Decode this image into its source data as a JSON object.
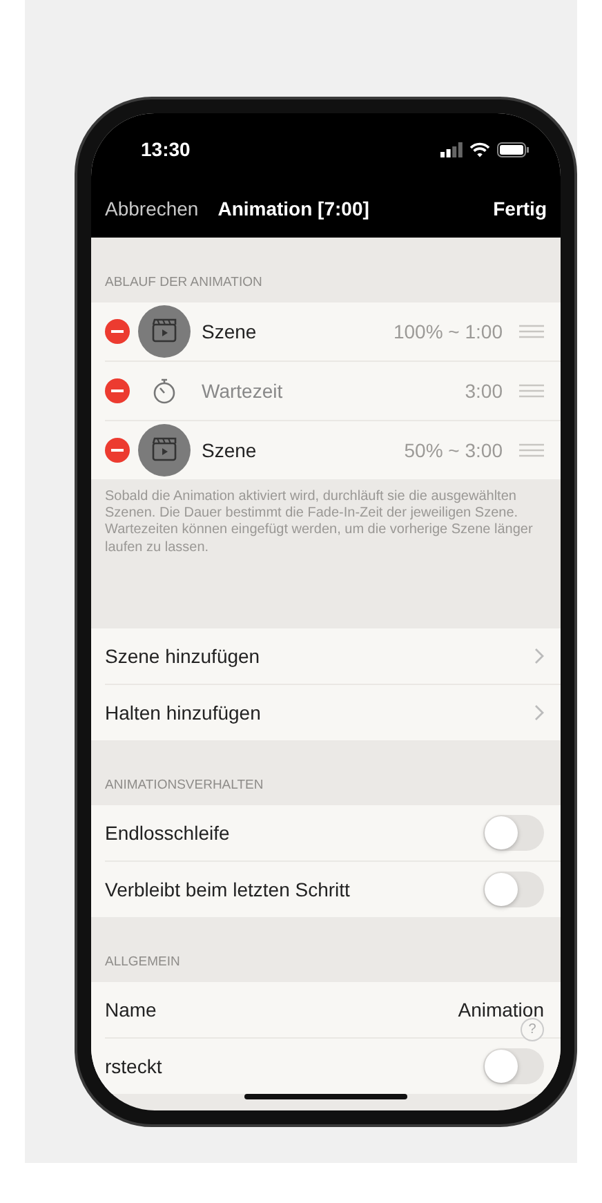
{
  "status_bar": {
    "time": "13:30"
  },
  "help": {
    "label": "?"
  },
  "nav": {
    "cancel": "Abbrechen",
    "title": "Animation [7:00]",
    "done": "Fertig"
  },
  "sections": [
    {
      "kind": "steps",
      "header": "ABLAUF DER ANIMATION",
      "footer": "Sobald die Animation aktiviert wird, durchläuft sie die ausgewählten Szenen. Die Dauer bestimmt die Fade-In-Zeit der jeweiligen Szene. Wartezeiten können eingefügt werden, um die vorherige Szene länger laufen zu lassen.",
      "rows": [
        {
          "kind": "scene",
          "label": "Szene",
          "value": "100% ~ 1:00"
        },
        {
          "kind": "wait",
          "label": "Wartezeit",
          "value": "3:00"
        },
        {
          "kind": "scene",
          "label": "Szene",
          "value": "50% ~ 3:00"
        }
      ]
    },
    {
      "kind": "links",
      "rows": [
        {
          "label": "Szene hinzufügen"
        },
        {
          "label": "Halten hinzufügen"
        }
      ]
    },
    {
      "kind": "toggles",
      "header": "ANIMATIONSVERHALTEN",
      "rows": [
        {
          "label": "Endlosschleife",
          "on": false
        },
        {
          "label": "Verbleibt beim letzten Schritt",
          "on": false
        }
      ]
    },
    {
      "kind": "general",
      "header": "ALLGEMEIN",
      "rows": [
        {
          "kind": "value",
          "label": "Name",
          "value": "Animation"
        },
        {
          "kind": "toggle",
          "label": "rsteckt",
          "on": false
        }
      ]
    }
  ]
}
